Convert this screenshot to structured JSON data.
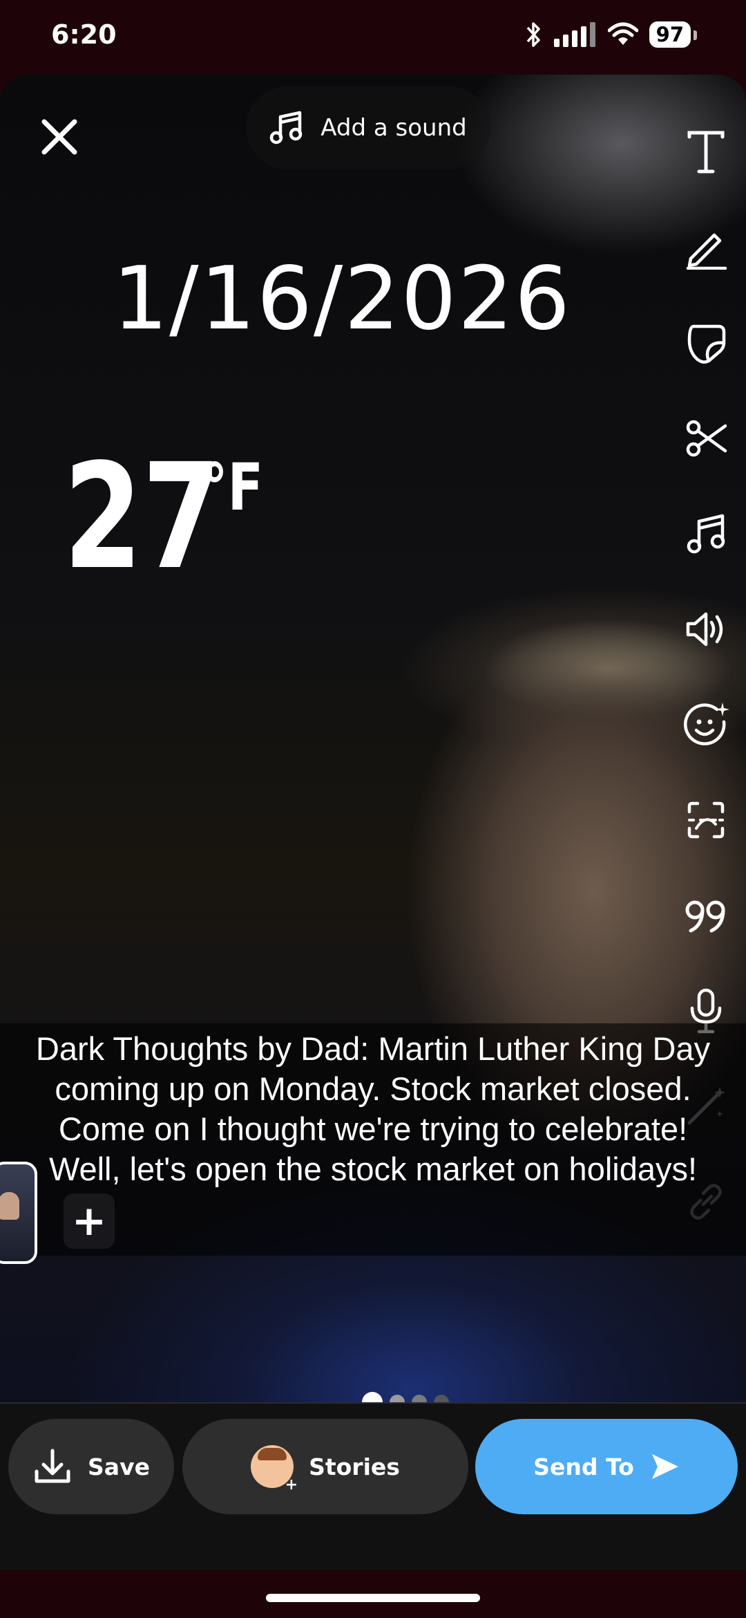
{
  "status_bar": {
    "time": "6:20",
    "battery": "97"
  },
  "editor": {
    "sound_button_label": "Add a sound",
    "date_sticker": "1/16/2026",
    "temperature": "27",
    "temperature_unit": "°F",
    "caption": "Dark Thoughts by Dad:  Martin Luther King Day coming up on Monday. Stock market closed. Come on I thought we're trying to celebrate!  Well, let's open the stock market on holidays!",
    "add_snap_symbol": "+",
    "toolbar_icons": [
      "text-icon",
      "pencil-icon",
      "sticker-icon",
      "scissors-icon",
      "music-icon",
      "speaker-icon",
      "sparkle-face-icon",
      "scan-icon",
      "quote-icon",
      "microphone-icon",
      "magic-wand-icon",
      "link-icon"
    ],
    "page_indicator": {
      "total": 4,
      "active": 1
    }
  },
  "bottom_actions": {
    "save_label": "Save",
    "stories_label": "Stories",
    "send_label": "Send To"
  },
  "colors": {
    "send_button": "#4eacf5",
    "dark_button": "#2e2e2e",
    "status_background": "#1e0408"
  }
}
